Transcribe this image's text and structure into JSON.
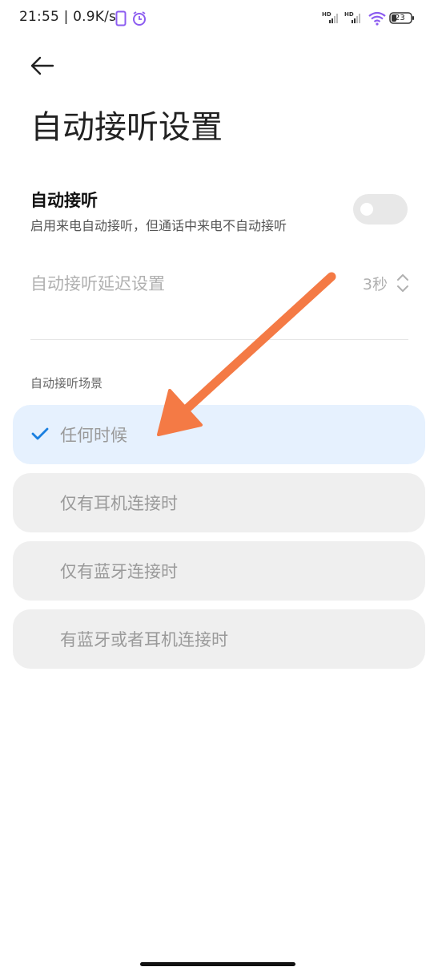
{
  "status_bar": {
    "time_speed": "21:55 | 0.9K/s",
    "battery": "23",
    "icons": [
      "phone-outline-icon",
      "alarm-icon",
      "hd-signal-icon",
      "hd-signal-icon",
      "wifi-icon",
      "battery-icon"
    ],
    "colors": {
      "phone_icon": "#8c5cf0",
      "alarm_icon": "#8c5cf0"
    }
  },
  "header": {
    "back_icon": "back-arrow-icon",
    "title": "自动接听设置"
  },
  "auto_answer": {
    "title": "自动接听",
    "subtitle": "启用来电自动接听，但通话中来电不自动接听",
    "enabled": false
  },
  "delay": {
    "label": "自动接听延迟设置",
    "value": "3秒",
    "icon": "up-down-chevron-icon"
  },
  "scenarios": {
    "section_label": "自动接听场景",
    "selected_index": 0,
    "check_icon": "checkmark-icon",
    "options": [
      {
        "label": "任何时候"
      },
      {
        "label": "仅有耳机连接时"
      },
      {
        "label": "仅有蓝牙连接时"
      },
      {
        "label": "有蓝牙或者耳机连接时"
      }
    ]
  },
  "annotation": {
    "type": "arrow",
    "color": "#f47a45"
  },
  "colors": {
    "accent": "#1a7fe0",
    "selected_bg": "#e6f1fe",
    "option_bg": "#efefef",
    "toggle_off": "#e8e8e8"
  }
}
